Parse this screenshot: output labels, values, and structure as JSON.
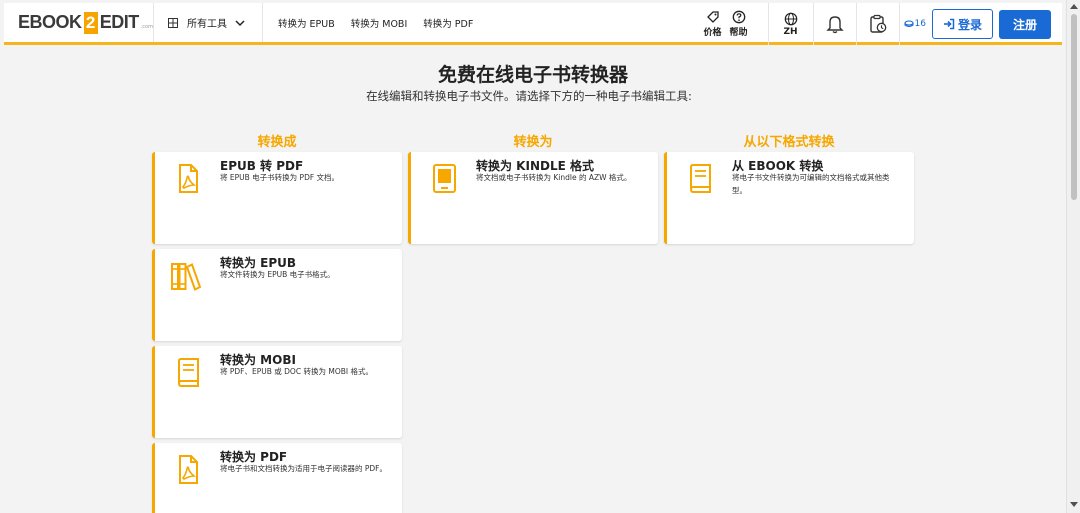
{
  "header": {
    "logo": {
      "part1": "EBOOK",
      "part2": "2",
      "part3": "EDIT",
      "small": ".com"
    },
    "tools_menu": "所有工具",
    "nav": [
      "转换为 EPUB",
      "转换为 MOBI",
      "转换为 PDF"
    ],
    "price_label": "价格",
    "help_label": "帮助",
    "lang_label": "ZH",
    "credits": "16",
    "login": "登录",
    "signup": "注册"
  },
  "page": {
    "title": "免费在线电子书转换器",
    "subtitle": "在线编辑和转换电子书文件。请选择下方的一种电子书编辑工具:"
  },
  "columns": [
    {
      "heading": "转换成",
      "cards": [
        {
          "title": "EPUB 转 PDF",
          "desc": "将 EPUB 电子书转换为 PDF 文档。",
          "icon": "pdf-file-icon"
        },
        {
          "title": "转换为 EPUB",
          "desc": "将文件转换为 EPUB 电子书格式。",
          "icon": "books-shelf-icon"
        },
        {
          "title": "转换为 MOBI",
          "desc": "将 PDF、EPUB 或 DOC 转换为 MOBI 格式。",
          "icon": "book-icon"
        },
        {
          "title": "转换为 PDF",
          "desc": "将电子书和文档转换为适用于电子阅读器的 PDF。",
          "icon": "pdf-file-icon"
        }
      ]
    },
    {
      "heading": "转换为",
      "cards": [
        {
          "title": "转换为 KINDLE 格式",
          "desc": "将文档或电子书转换为 Kindle 的 AZW 格式。",
          "icon": "ereader-icon"
        }
      ]
    },
    {
      "heading": "从以下格式转换",
      "cards": [
        {
          "title": "从 EBOOK 转换",
          "desc": "将电子书文件转换为可编辑的文档格式或其他类型。",
          "icon": "book-icon"
        }
      ]
    }
  ],
  "colors": {
    "accent": "#f6a700",
    "primary": "#1a6ad6",
    "background": "#f3f3f3"
  }
}
